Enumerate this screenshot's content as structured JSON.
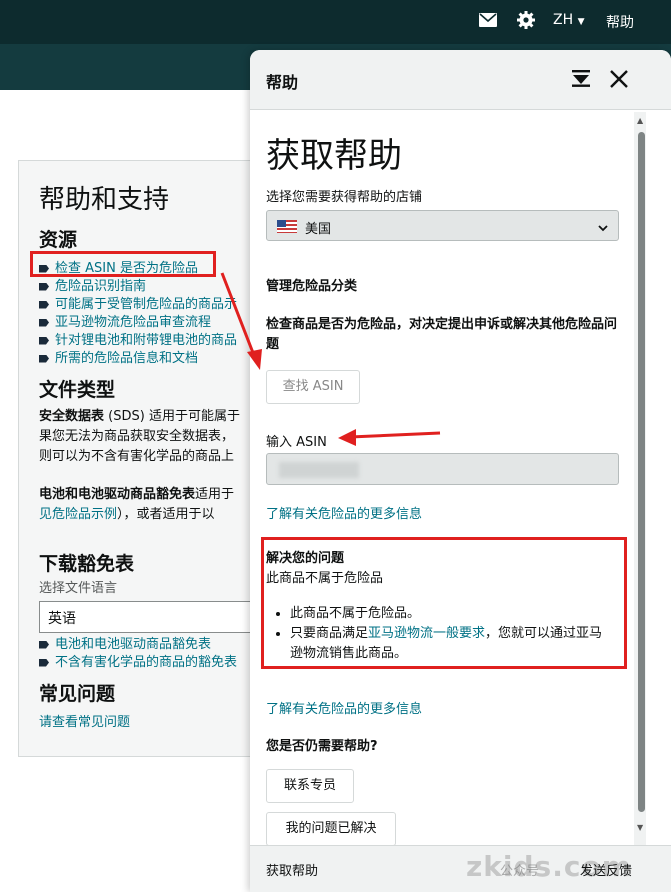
{
  "topbar": {
    "mail_icon": "mail-icon",
    "settings_icon": "gear-icon",
    "language": "ZH",
    "help": "帮助"
  },
  "background": {
    "title": "帮助和支持",
    "resources_heading": "资源",
    "resources": [
      "检查 ASIN 是否为危险品",
      "危险品识别指南",
      "可能属于受管制危险品的商品示",
      "亚马逊物流危险品审查流程",
      "针对锂电池和附带锂电池的商品",
      "所需的危险品信息和文档"
    ],
    "file_types_heading": "文件类型",
    "sds_bold": "安全数据表",
    "sds_text": " (SDS) 适用于可能属于",
    "sds_line2": "果您无法为商品获取安全数据表，",
    "sds_line3": "则可以为不含有害化学品的商品上",
    "battery_bold": "电池和电池驱动商品豁免表",
    "battery_text": "适用于",
    "battery_line2_link": "见危险品示例",
    "battery_line2_text": "），或者适用于以",
    "download_heading": "下载豁免表",
    "select_language_label": "选择文件语言",
    "language_value": "英语",
    "download_links": [
      "电池和电池驱动商品豁免表",
      "不含有害化学品的商品的豁免表"
    ],
    "faq_heading": "常见问题",
    "faq_link": "请查看常见问题"
  },
  "drawer": {
    "header_title": "帮助",
    "big_title": "获取帮助",
    "store_label": "选择您需要获得帮助的店铺",
    "store_value": "美国",
    "manage_heading": "管理危险品分类",
    "check_heading": "检查商品是否为危险品，对决定提出申诉或解决其他危险品问题",
    "find_asin_button": "查找 ASIN",
    "asin_label": "输入 ASIN",
    "learn_more_1": "了解有关危险品的更多信息",
    "resolve_heading": "解决您的问题",
    "resolve_subtitle": "此商品不属于危险品",
    "bullet_1": "此商品不属于危险品。",
    "bullet_2_prefix": "只要商品满足",
    "bullet_2_link": "亚马逊物流一般要求",
    "bullet_2_suffix": "，您就可以通过亚马逊物流销售此商品。",
    "learn_more_2": "了解有关危险品的更多信息",
    "still_need_help": "您是否仍需要帮助?",
    "contact_button": "联系专员",
    "resolved_button": "我的问题已解决",
    "footer_left": "获取帮助",
    "footer_right": "发送反馈",
    "watermark": "zkids.com",
    "watermark_sub": "公众号"
  },
  "colors": {
    "topbar": "#0d2b2e",
    "link": "#007185",
    "highlight": "#e0201f"
  }
}
